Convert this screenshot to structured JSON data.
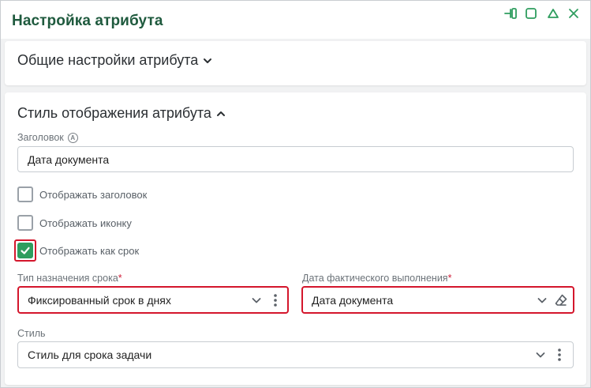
{
  "window": {
    "title": "Настройка атрибута",
    "controls": [
      "pin-icon",
      "maximize-icon",
      "collapse-icon",
      "close-icon"
    ]
  },
  "general_section": {
    "title": "Общие настройки атрибута",
    "expanded": false
  },
  "display_section": {
    "title": "Стиль отображения атрибута",
    "expanded": true,
    "header_field": {
      "label": "Заголовок",
      "value": "Дата документа"
    },
    "checkboxes": [
      {
        "label": "Отображать заголовок",
        "checked": false
      },
      {
        "label": "Отображать иконку",
        "checked": false
      },
      {
        "label": "Отображать как срок",
        "checked": true
      }
    ],
    "term_type": {
      "label": "Тип назначения срока",
      "required_mark": "*",
      "value": "Фиксированный срок в днях"
    },
    "actual_date": {
      "label": "Дата фактического выполнения",
      "required_mark": "*",
      "value": "Дата документа"
    },
    "style": {
      "label": "Стиль",
      "value": "Стиль для срока задачи"
    }
  },
  "colors": {
    "accent_green": "#2e9d5e",
    "title_green": "#1f5a3e",
    "highlight_red": "#d4162c"
  }
}
